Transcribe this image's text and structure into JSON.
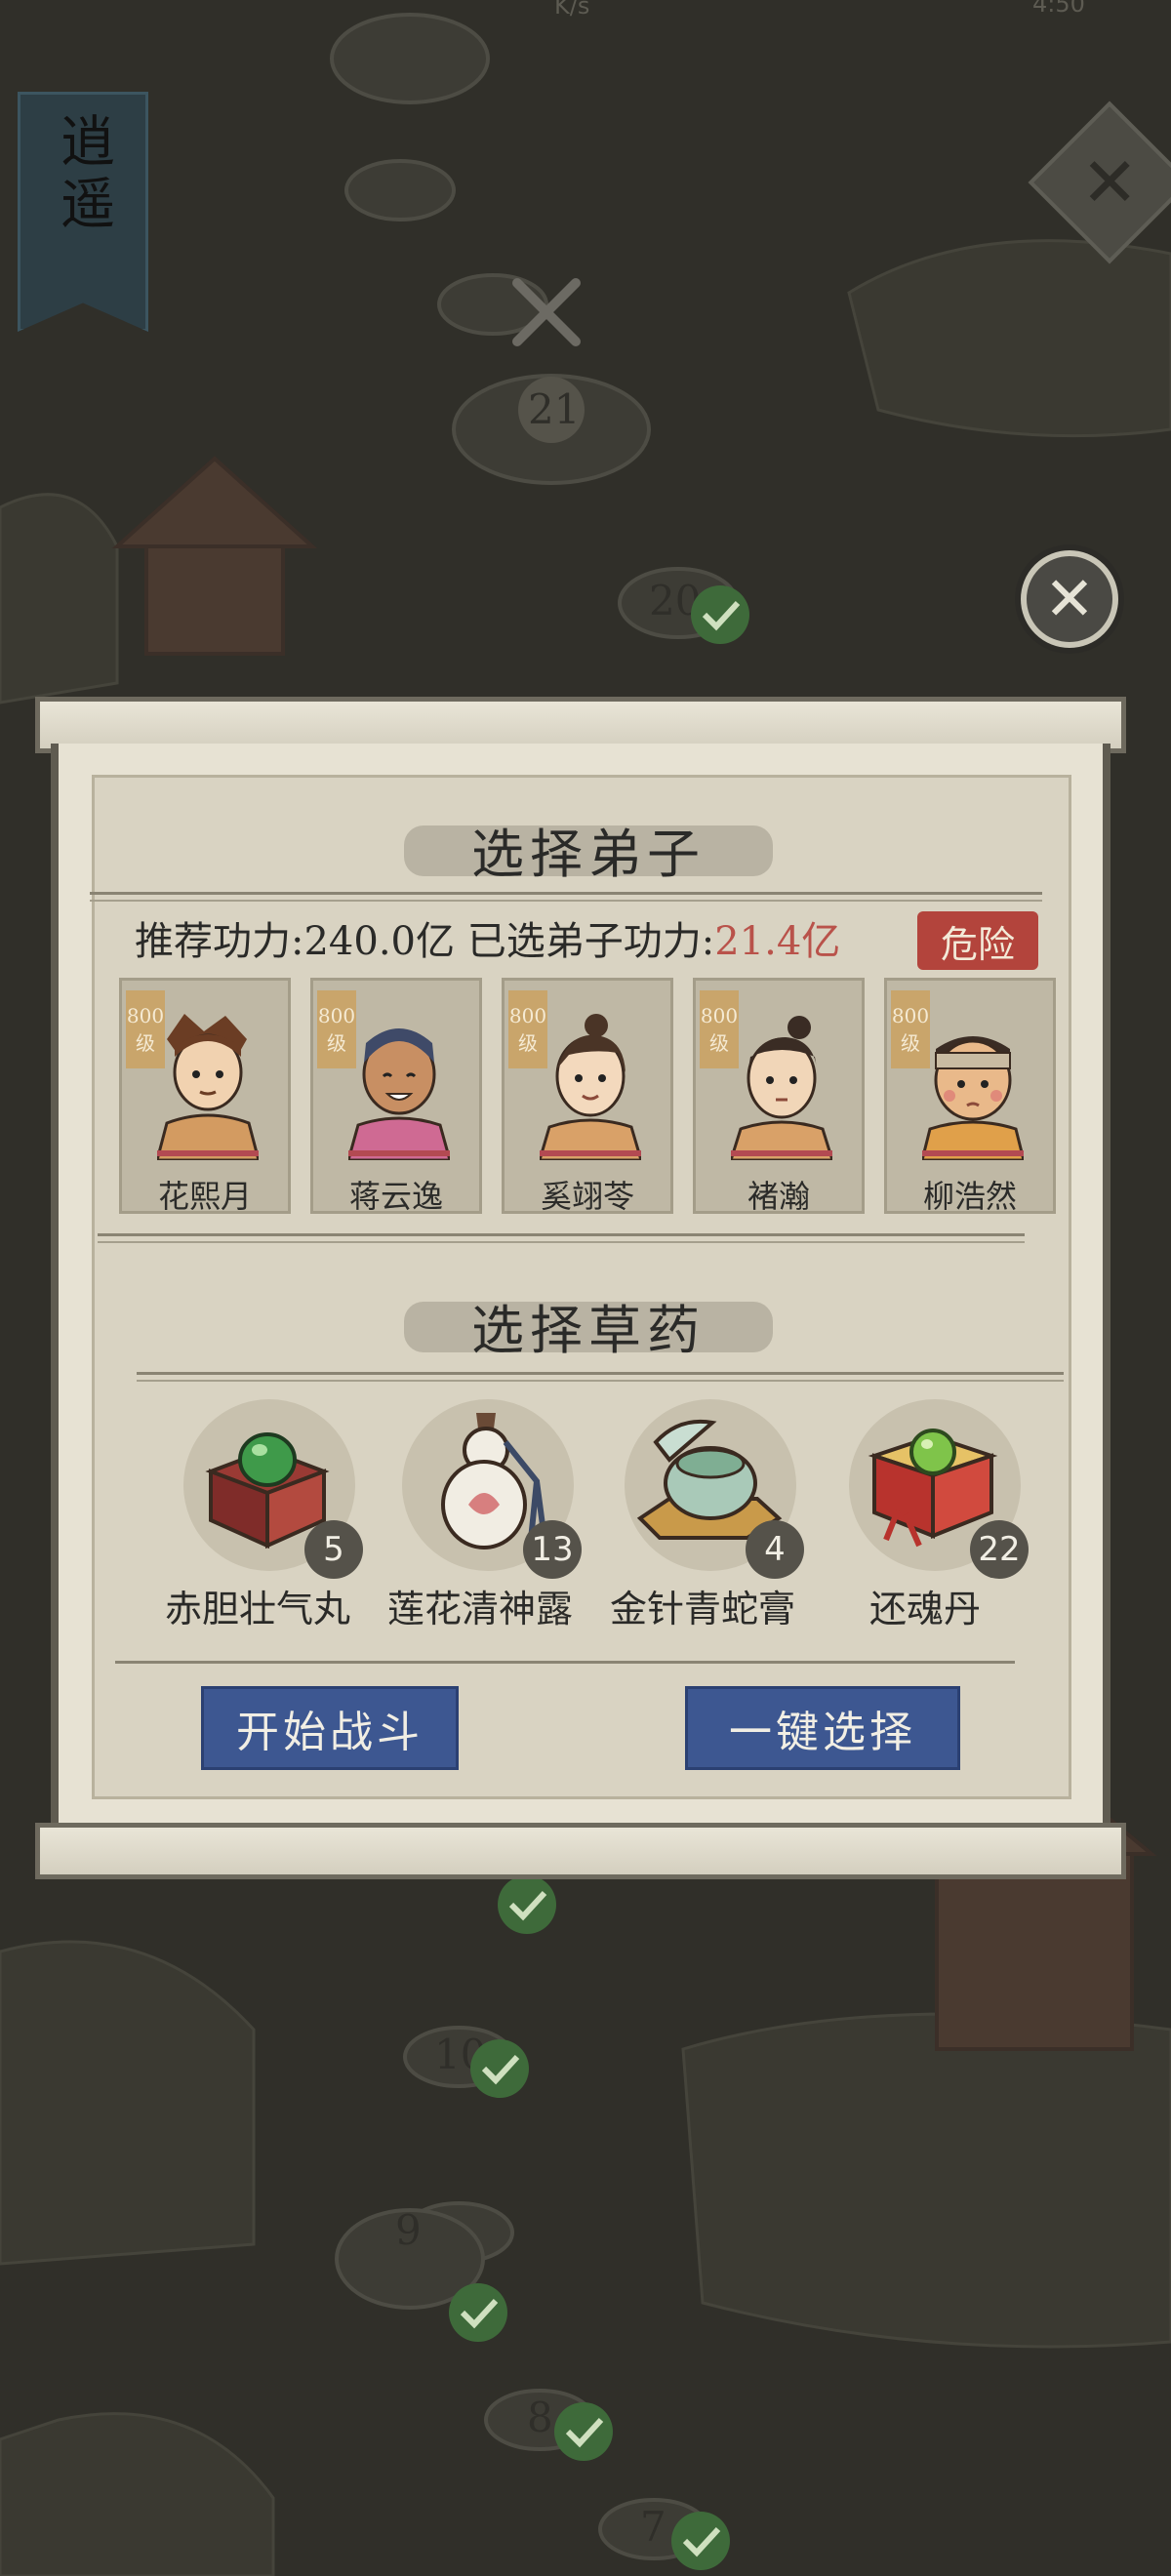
{
  "status_bar": {
    "netspeed": "K/s",
    "clock": "4:50"
  },
  "side_banner": {
    "label": "逍遥"
  },
  "map_nodes": [
    {
      "label": "21",
      "done": false
    },
    {
      "label": "20",
      "done": true
    },
    {
      "label": "10",
      "done": true
    },
    {
      "label": "9",
      "done": true
    },
    {
      "label": "8",
      "done": true
    },
    {
      "label": "7",
      "done": true
    }
  ],
  "dialog": {
    "disciple_title": "选择弟子",
    "recommended_label": "推荐功力:",
    "recommended_value": "240.0亿",
    "selected_label": "已选弟子功力:",
    "selected_value": "21.4亿",
    "danger_badge": "危险",
    "disciples": [
      {
        "name": "花熙月",
        "level": "800",
        "level_unit": "级"
      },
      {
        "name": "蒋云逸",
        "level": "800",
        "level_unit": "级"
      },
      {
        "name": "奚翊苓",
        "level": "800",
        "level_unit": "级"
      },
      {
        "name": "褚瀚",
        "level": "800",
        "level_unit": "级"
      },
      {
        "name": "柳浩然",
        "level": "800",
        "level_unit": "级"
      }
    ],
    "herb_title": "选择草药",
    "herbs": [
      {
        "name": "赤胆壮气丸",
        "count": "5",
        "icon": "pill-box-icon"
      },
      {
        "name": "莲花清神露",
        "count": "13",
        "icon": "gourd-bottle-icon"
      },
      {
        "name": "金针青蛇膏",
        "count": "4",
        "icon": "jade-jar-icon"
      },
      {
        "name": "还魂丹",
        "count": "22",
        "icon": "gift-box-pill-icon"
      }
    ],
    "start_button": "开始战斗",
    "auto_select_button": "一键选择"
  }
}
